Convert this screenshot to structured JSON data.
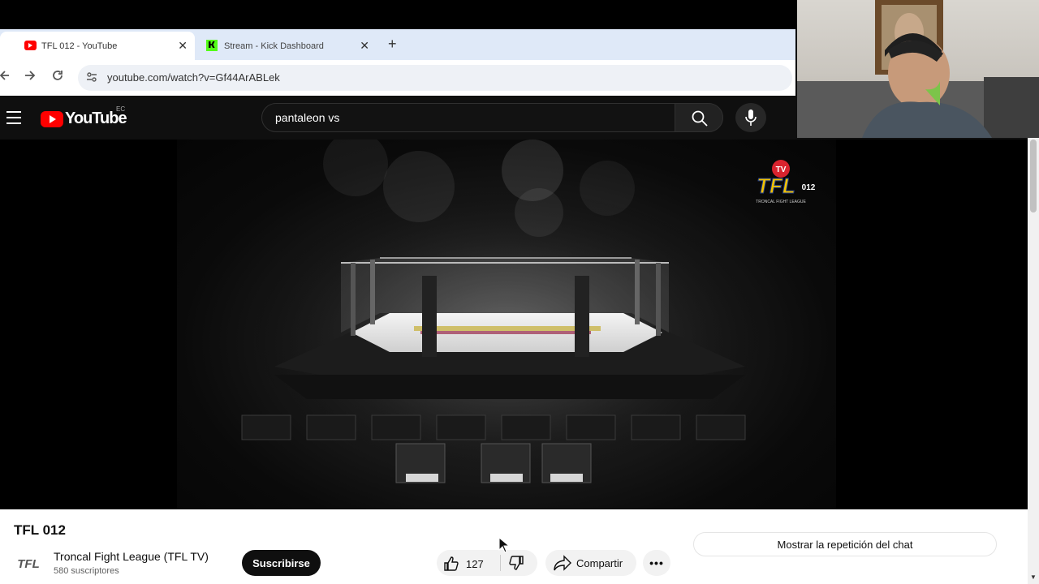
{
  "browser": {
    "tabs": [
      {
        "title": "TFL 012 - YouTube",
        "active": true,
        "favicon": "youtube-icon"
      },
      {
        "title": "Stream - Kick Dashboard",
        "active": false,
        "favicon": "kick-icon"
      }
    ],
    "close_glyph": "✕",
    "new_tab_glyph": "+",
    "url": "youtube.com/watch?v=Gf44ArABLek"
  },
  "youtube": {
    "logo_text": "YouTube",
    "country_code": "EC",
    "search_query": "pantaleon vs"
  },
  "video": {
    "title": "TFL 012",
    "overlay_logo": {
      "badge": "TV",
      "text": "TFL",
      "number": "012",
      "subtitle": "TRONCAL FIGHT LEAGUE"
    }
  },
  "channel": {
    "name": "Troncal Fight League (TFL TV)",
    "avatar_text": "TFL",
    "subscribers": "580 suscriptores",
    "subscribe_label": "Suscribirse"
  },
  "actions": {
    "likes": "127",
    "share_label": "Compartir",
    "more_glyph": "•••"
  },
  "chat": {
    "replay_label": "Mostrar la repetición del chat"
  },
  "colors": {
    "youtube_red": "#ff0000",
    "kick_green": "#53fc18",
    "yt_dark": "#0f0f0f",
    "tab_bar": "#dfe9f8"
  }
}
